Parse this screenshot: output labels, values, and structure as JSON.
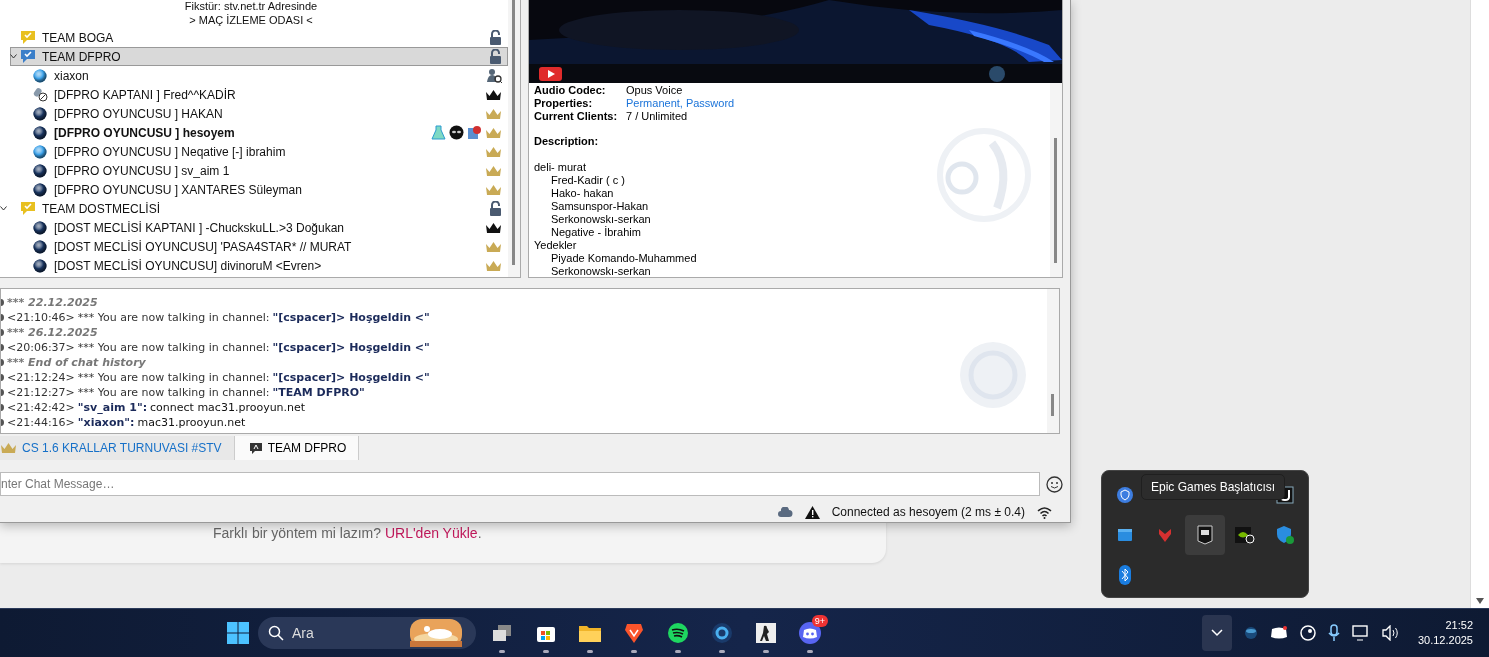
{
  "tree": [
    {
      "kind": "spacer",
      "text": "Fikstür: stv.net.tr  Adresinde"
    },
    {
      "kind": "spacer",
      "text": "> MAÇ İZLEME ODASI <"
    },
    {
      "kind": "channel",
      "name": "TEAM BOGA",
      "current": false,
      "selected": false,
      "expanded": false,
      "locked": true
    },
    {
      "kind": "channel",
      "name": "TEAM DFPRO",
      "current": true,
      "selected": true,
      "expanded": true,
      "locked": true,
      "children": [
        {
          "kind": "query",
          "name": "xiaxon",
          "muted": false,
          "lit": true,
          "self": false,
          "has_badges": false
        },
        {
          "kind": "captain",
          "name": "[DFPRO KAPTANI  ] Fred^^KADİR",
          "muted": true,
          "lit": false,
          "self": false,
          "has_badges": false
        },
        {
          "kind": "player",
          "name": "[DFPRO OYUNCUSU ] HAKAN",
          "muted": false,
          "lit": false,
          "self": false,
          "has_badges": false
        },
        {
          "kind": "player",
          "name": "[DFPRO OYUNCUSU ] hesoyem",
          "muted": false,
          "lit": false,
          "self": true,
          "has_badges": true
        },
        {
          "kind": "player",
          "name": "[DFPRO OYUNCUSU ] Neqative  [-] ibrahim",
          "muted": false,
          "lit": true,
          "self": false,
          "has_badges": false
        },
        {
          "kind": "player",
          "name": "[DFPRO OYUNCUSU ] sv_aim 1",
          "muted": false,
          "lit": false,
          "self": false,
          "has_badges": false
        },
        {
          "kind": "player",
          "name": "[DFPRO OYUNCUSU ] XANTARES Süleyman",
          "muted": false,
          "lit": false,
          "self": false,
          "has_badges": false
        }
      ]
    },
    {
      "kind": "channel",
      "name": "TEAM DOSTMECLİSİ",
      "current": false,
      "selected": false,
      "expanded": true,
      "locked": true,
      "children": [
        {
          "kind": "captain",
          "name": "[DOST MECLİSİ KAPTANI ] -ChuckskuLL.>3 Doğukan",
          "muted": false,
          "lit": false,
          "self": false,
          "has_badges": false
        },
        {
          "kind": "player",
          "name": "[DOST MECLİSİ OYUNCUSU] 'PASA4STAR*  // MURAT",
          "muted": false,
          "lit": false,
          "self": false,
          "has_badges": false
        },
        {
          "kind": "player",
          "name": "[DOST MECLİSİ OYUNCUSU] divinoruM   <Evren>",
          "muted": false,
          "lit": false,
          "self": false,
          "has_badges": false
        }
      ]
    }
  ],
  "info": {
    "rows": [
      {
        "label": "Audio Codec:",
        "value": "Opus Voice",
        "link": false
      },
      {
        "label": "Properties:",
        "value": "Permanent, Password",
        "link": true
      },
      {
        "label": "Current Clients:",
        "value": "7 / Unlimited",
        "link": false
      }
    ],
    "description_title": "Description:",
    "description": [
      {
        "text": "deli- murat",
        "children": [
          {
            "text": "Fred-Kadir ( c )"
          },
          {
            "text": "Hako- hakan"
          },
          {
            "text": "Samsunspor-Hakan"
          },
          {
            "text": "Serkonowskı-serkan"
          },
          {
            "text": "Negative - İbrahim"
          }
        ]
      },
      {
        "text": "Yedekler",
        "children": [
          {
            "text": "Piyade Komando-Muhammed"
          },
          {
            "text": "Serkonowskı-serkan"
          }
        ]
      }
    ]
  },
  "chat": [
    {
      "kind": "date",
      "text": "*** 22.12.2025"
    },
    {
      "kind": "system",
      "time": "<21:10:46>",
      "text": "*** You are now talking in channel:",
      "channel": "\"[cspacer]> Hoşgeldin <\""
    },
    {
      "kind": "date",
      "text": "*** 26.12.2025"
    },
    {
      "kind": "system",
      "time": "<20:06:37>",
      "text": "*** You are now talking in channel:",
      "channel": "\"[cspacer]> Hoşgeldin <\""
    },
    {
      "kind": "date",
      "text": "*** End of chat history"
    },
    {
      "kind": "system",
      "time": "<21:12:24>",
      "text": "*** You are now talking in channel:",
      "channel": "\"[cspacer]> Hoşgeldin <\""
    },
    {
      "kind": "system",
      "time": "<21:12:27>",
      "text": "*** You are now talking in channel:",
      "channel": "\"TEAM DFPRO\""
    },
    {
      "kind": "message",
      "time": "<21:42:42>",
      "sender": "\"sv_aim 1\":",
      "text": "connect mac31.prooyun.net"
    },
    {
      "kind": "message",
      "time": "<21:44:16>",
      "sender": "\"xiaxon\":",
      "text": "mac31.prooyun.net"
    }
  ],
  "chat_tabs": [
    {
      "label": "CS 1.6 KRALLAR TURNUVASI #STV",
      "kind": "server",
      "selected": false
    },
    {
      "label": "TEAM DFPRO",
      "kind": "channel",
      "selected": true
    }
  ],
  "chat_input": {
    "placeholder": "nter Chat Message…"
  },
  "status_bar": {
    "text": "Connected as hesoyem (2 ms ± 0.4)"
  },
  "web_page": {
    "text": "Farklı bir yöntem mi lazım?",
    "link": "URL'den Yükle",
    "after": "."
  },
  "tray_popup": {
    "tooltip": "Epic Games Başlatıcısı",
    "icons": [
      {
        "selected": false
      },
      {
        "selected": false
      },
      {
        "selected": false
      },
      {
        "selected": false
      },
      {
        "selected": true
      },
      {
        "selected": false
      },
      {
        "selected": false
      },
      {
        "selected": false
      }
    ]
  },
  "taskbar": {
    "search": {
      "placeholder": "Ara"
    },
    "apps": [
      {
        "running": true
      },
      {
        "running": true
      },
      {
        "running": true
      },
      {
        "running": true
      },
      {
        "running": true
      },
      {
        "running": true
      },
      {
        "running": true
      },
      {
        "running": true,
        "badge": "9+"
      }
    ],
    "time": "21:52",
    "date": "30.12.2025"
  }
}
